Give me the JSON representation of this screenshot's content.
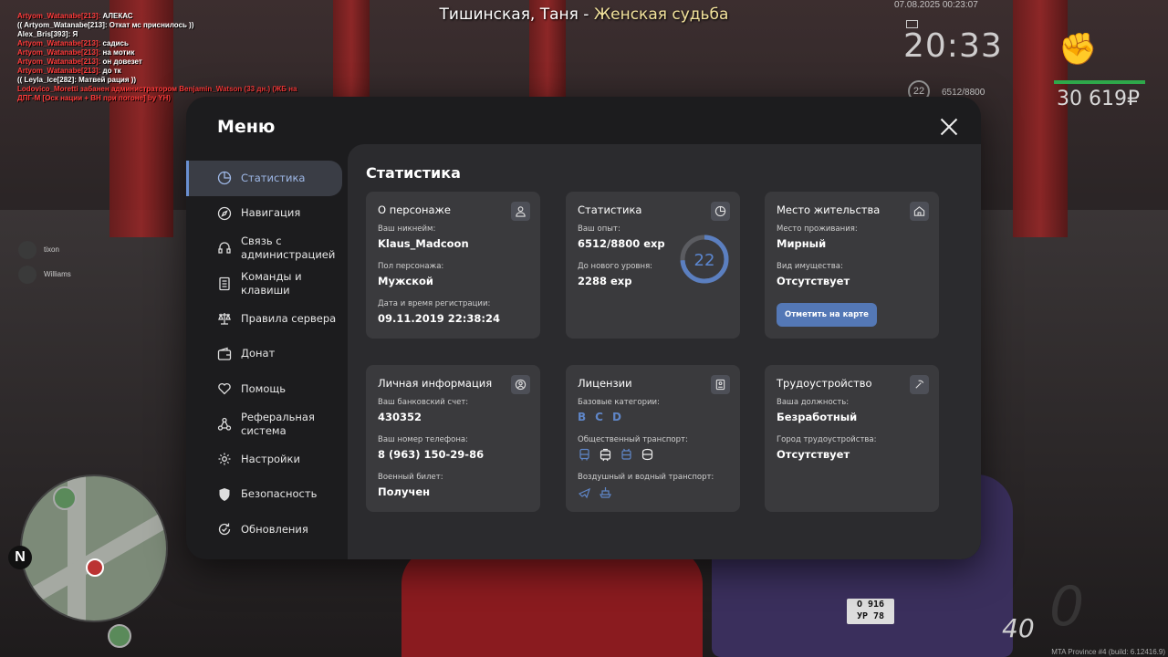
{
  "chat": [
    {
      "name": "Artyom_Watanabe[213]:",
      "text": " АЛЕКАС",
      "color": "red"
    },
    {
      "name": "",
      "text": "(( Artyom_Watanabe[213]: Откат мс приснилось ))",
      "color": "white"
    },
    {
      "name": "",
      "text": "Alex_Bris[393]: Я",
      "color": "white"
    },
    {
      "name": "Artyom_Watanabe[213]:",
      "text": " садись",
      "color": "red"
    },
    {
      "name": "Artyom_Watanabe[213]:",
      "text": " на мотик",
      "color": "red"
    },
    {
      "name": "Artyom_Watanabe[213]:",
      "text": " он довезет",
      "color": "red"
    },
    {
      "name": "Artyom_Watanabe[213]:",
      "text": " до тк",
      "color": "red"
    },
    {
      "name": "",
      "text": "(( Leyla_Ice[282]: Матвей рация ))",
      "color": "white"
    },
    {
      "name": "",
      "text": "Lodovico_Moretti забанен администратором Benjamin_Watson (33 дн.) (ЖБ на",
      "color": "red"
    },
    {
      "name": "",
      "text": "ДПГ-М [Оск нации + ВН при погоне] by YH)",
      "color": "red"
    }
  ],
  "top_title": {
    "part1": "Тишинская, Таня - ",
    "part2": "Женская судьба"
  },
  "hud": {
    "date": "07.08.2025 00:23:07",
    "time": "20:33",
    "level": "22",
    "exp": "6512/8800",
    "money": "30 619₽",
    "speed": "40"
  },
  "players": [
    "tixon",
    "Williams"
  ],
  "radar": {
    "north": "N"
  },
  "build": "MTA Province #4 (build: 6.12416.9)",
  "plate": {
    "line1": "О 916",
    "line2": "УР 78"
  },
  "menu": {
    "title": "Меню",
    "sidebar": [
      {
        "label": "Статистика",
        "icon": "pie-chart-icon",
        "active": true
      },
      {
        "label": "Навигация",
        "icon": "compass-icon"
      },
      {
        "label": "Связь с администрацией",
        "icon": "headset-icon"
      },
      {
        "label": "Команды и клавиши",
        "icon": "document-icon"
      },
      {
        "label": "Правила сервера",
        "icon": "scales-icon"
      },
      {
        "label": "Донат",
        "icon": "wallet-icon"
      },
      {
        "label": "Помощь",
        "icon": "heart-hand-icon"
      },
      {
        "label": "Реферальная система",
        "icon": "network-icon"
      },
      {
        "label": "Настройки",
        "icon": "gear-icon"
      },
      {
        "label": "Безопасность",
        "icon": "shield-icon"
      },
      {
        "label": "Обновления",
        "icon": "refresh-check-icon"
      }
    ],
    "content_title": "Статистика",
    "cards": {
      "character": {
        "title": "О персонаже",
        "nick_label": "Ваш никнейм:",
        "nick": "Klaus_Madcoon",
        "gender_label": "Пол персонажа:",
        "gender": "Мужской",
        "reg_label": "Дата и время регистрации:",
        "reg": "09.11.2019 22:38:24"
      },
      "stats": {
        "title": "Статистика",
        "exp_label": "Ваш опыт:",
        "exp": "6512/8800 exp",
        "next_label": "До нового уровня:",
        "next": "2288 exp",
        "level": "22",
        "progress": 0.74
      },
      "residence": {
        "title": "Место жительства",
        "place_label": "Место проживания:",
        "place": "Мирный",
        "property_label": "Вид имущества:",
        "property": "Отсутствует",
        "button": "Отметить на карте"
      },
      "personal": {
        "title": "Личная информация",
        "bank_label": "Ваш банковский счет:",
        "bank": "430352",
        "phone_label": "Ваш номер телефона:",
        "phone": "8 (963) 150-29-86",
        "military_label": "Военный билет:",
        "military": "Получен"
      },
      "licenses": {
        "title": "Лицензии",
        "base_label": "Базовые категории:",
        "base": [
          "B",
          "C",
          "D"
        ],
        "public_label": "Общественный транспорт:",
        "public_icons": [
          "bus-icon",
          "tram-icon",
          "trolleybus-icon",
          "metro-icon"
        ],
        "air_label": "Воздушный и водный транспорт:",
        "air_icons": [
          "plane-icon",
          "ship-icon"
        ]
      },
      "job": {
        "title": "Трудоустройство",
        "position_label": "Ваша должность:",
        "position": "Безработный",
        "city_label": "Город трудоустройства:",
        "city": "Отсутствует"
      }
    }
  }
}
